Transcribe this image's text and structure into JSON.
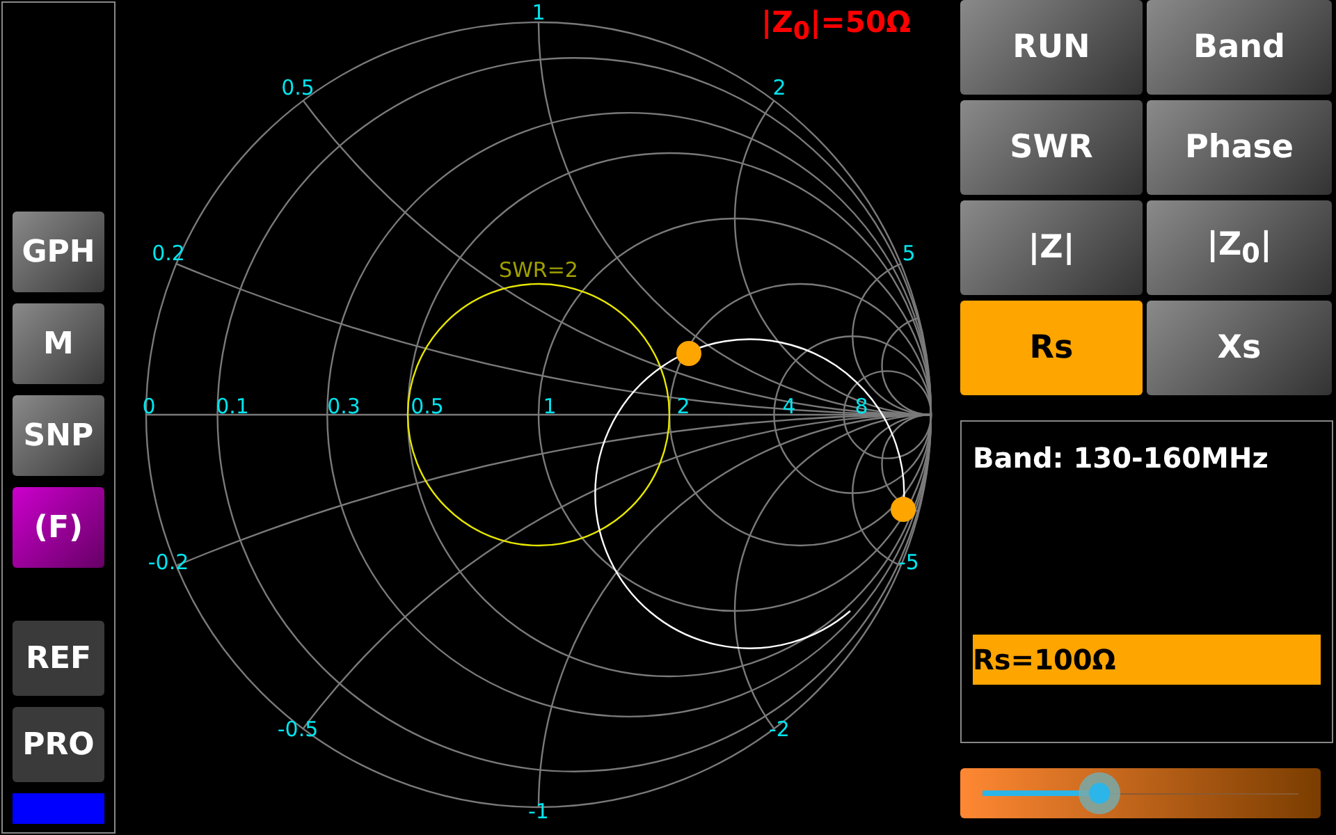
{
  "sidebar": {
    "buttons": [
      {
        "label": "GPH",
        "kind": "raised",
        "selected": false
      },
      {
        "label": "M",
        "kind": "raised",
        "selected": false
      },
      {
        "label": "SNP",
        "kind": "raised",
        "selected": false
      },
      {
        "label": "(F)",
        "kind": "raised",
        "selected": true
      },
      {
        "label": "REF",
        "kind": "flat",
        "selected": false
      },
      {
        "label": "PRO",
        "kind": "flat",
        "selected": false
      }
    ]
  },
  "smith_chart": {
    "impedance": "|Z$_{0}$|=50Ω",
    "swr_label": "SWR=2",
    "resistance_labels": [
      "0",
      "0.1",
      "0.3",
      "0.5",
      "1",
      "2",
      "4",
      "8"
    ],
    "reactance_labels": [
      "1",
      "0.5",
      "2",
      "0.2",
      "5",
      "-0.2",
      "-5",
      "-0.5",
      "-2",
      "-1"
    ]
  },
  "mode_buttons": [
    {
      "label": "RUN",
      "selected": false
    },
    {
      "label": "Band",
      "selected": false
    },
    {
      "label": "SWR",
      "selected": false
    },
    {
      "label": "Phase",
      "selected": false
    },
    {
      "label": "|Z|",
      "selected": false
    },
    {
      "label": "|Z$_{0}$|",
      "selected": false
    },
    {
      "label": "Rs",
      "selected": true
    },
    {
      "label": "Xs",
      "selected": false
    }
  ],
  "info_panel": {
    "band": "Band: 130-160MHz",
    "value": "Rs=100Ω"
  },
  "slider": {
    "level": 0.37
  }
}
